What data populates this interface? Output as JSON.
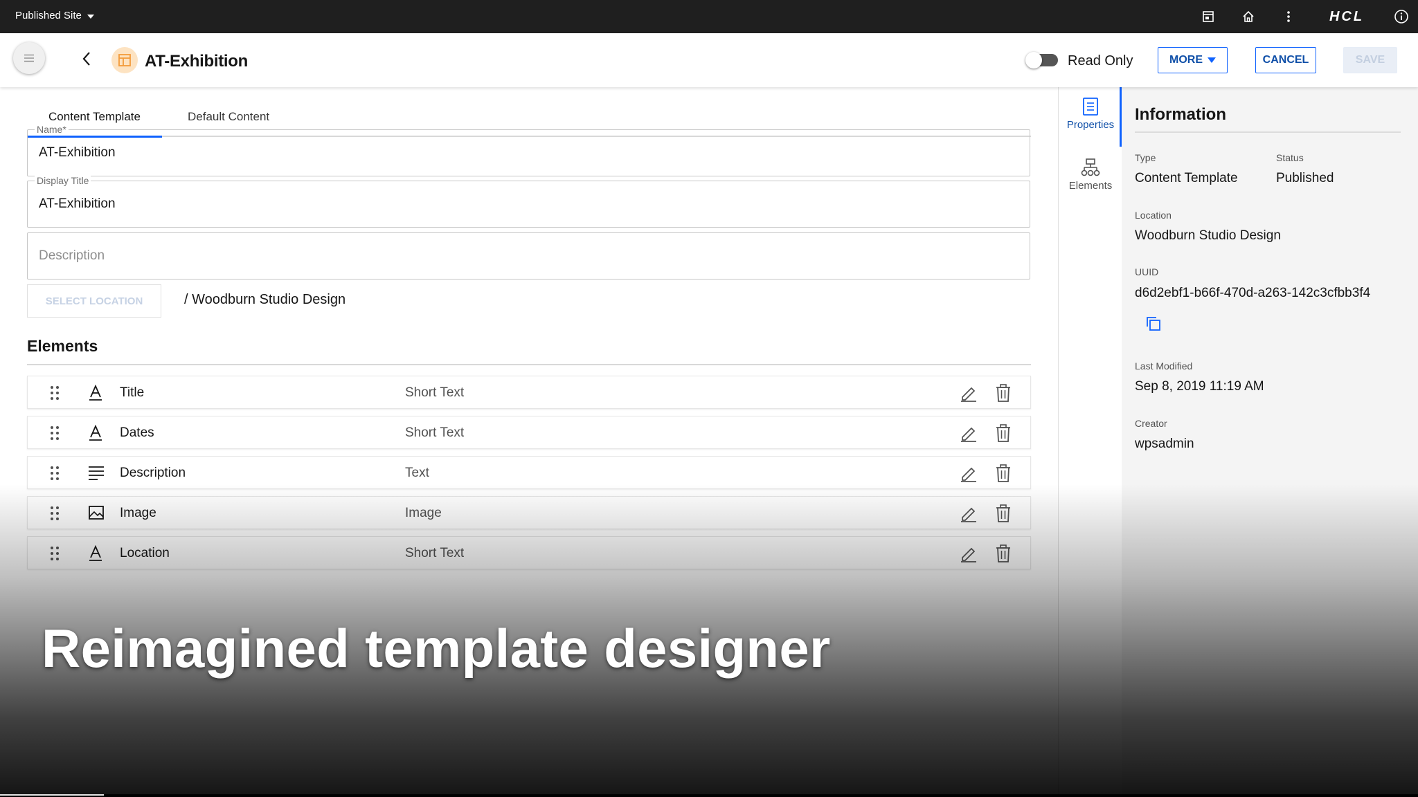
{
  "topbar": {
    "site_switcher": "Published Site",
    "brand": "HCL",
    "icons": [
      "page-icon",
      "home-icon",
      "more-vertical-icon",
      "info-icon"
    ]
  },
  "header": {
    "title": "AT-Exhibition",
    "read_only_label": "Read Only",
    "read_only_on": false,
    "more_label": "MORE",
    "cancel_label": "CANCEL",
    "save_label": "SAVE"
  },
  "tabs": [
    {
      "label": "Content Template",
      "active": true
    },
    {
      "label": "Default Content",
      "active": false
    }
  ],
  "form": {
    "name": {
      "label": "Name*",
      "value": "AT-Exhibition"
    },
    "display_title": {
      "label": "Display Title",
      "value": "AT-Exhibition"
    },
    "description": {
      "placeholder": "Description"
    },
    "select_location_label": "SELECT LOCATION",
    "location_path": "/ Woodburn Studio Design"
  },
  "elements": {
    "heading": "Elements",
    "rows": [
      {
        "name": "Title",
        "type": "Short Text",
        "icon": "text-icon"
      },
      {
        "name": "Dates",
        "type": "Short Text",
        "icon": "text-icon"
      },
      {
        "name": "Description",
        "type": "Text",
        "icon": "paragraph-icon"
      },
      {
        "name": "Image",
        "type": "Image",
        "icon": "image-icon"
      },
      {
        "name": "Location",
        "type": "Short Text",
        "icon": "text-icon"
      }
    ]
  },
  "rail": {
    "properties_label": "Properties",
    "elements_label": "Elements"
  },
  "info": {
    "title": "Information",
    "type_label": "Type",
    "type_value": "Content Template",
    "status_label": "Status",
    "status_value": "Published",
    "location_label": "Location",
    "location_value": "Woodburn Studio Design",
    "uuid_label": "UUID",
    "uuid_value": "d6d2ebf1-b66f-470d-a263-142c3cfbb3f4",
    "last_modified_label": "Last Modified",
    "last_modified_value": "Sep 8, 2019 11:19 AM",
    "creator_label": "Creator",
    "creator_value": "wpsadmin"
  },
  "caption": "Reimagined template designer",
  "colors": {
    "accent": "#0f62fe",
    "topbar": "#1f1f1f",
    "panel": "#f4f4f4"
  }
}
